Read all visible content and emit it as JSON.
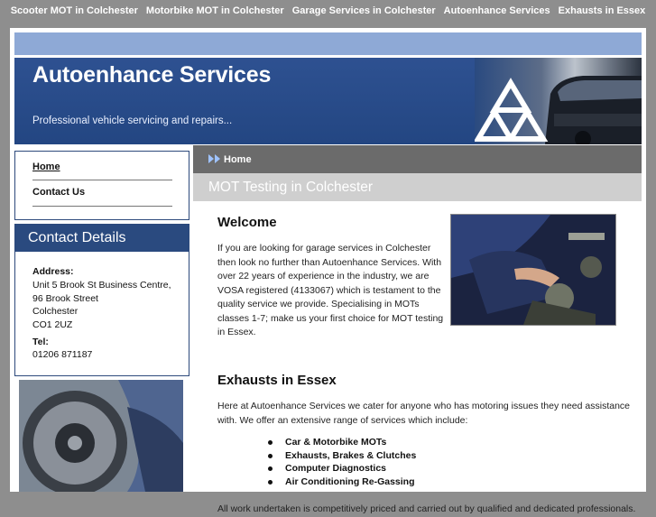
{
  "topnav": [
    "Scooter MOT in Colchester",
    "Motorbike MOT in Colchester",
    "Garage Services in Colchester",
    "Autoenhance Services",
    "Exhausts in Essex"
  ],
  "header": {
    "title": "Autoenhance Services",
    "tagline": "Professional vehicle servicing and repairs..."
  },
  "sidebar": {
    "nav": [
      "Home",
      "Contact Us"
    ],
    "contact": {
      "heading": "Contact Details",
      "address_label": "Address:",
      "address_lines": [
        "Unit 5 Brook St Business Centre,",
        "96 Brook Street",
        "Colchester",
        "CO1 2UZ"
      ],
      "tel_label": "Tel:",
      "tel": "01206 871187"
    }
  },
  "main": {
    "breadcrumb": "Home",
    "page_title": "MOT Testing in Colchester",
    "welcome_heading": "Welcome",
    "welcome_lines": [
      "If you are looking for garage services in Colchester",
      "then look no further than Autoenhance Services. With",
      "over 22 years of experience in the industry, we are",
      "VOSA registered (4133067) which is testament to the",
      "quality service we provide. Specialising in MOTs",
      "classes 1-7; make us your first choice for MOT testing",
      "in Essex."
    ],
    "exhausts_heading": "Exhausts in Essex",
    "exhausts_lines": [
      "Here at Autoenhance Services we cater for anyone who has motoring issues they need assistance",
      "with. We offer an extensive range of services which include:"
    ],
    "services": [
      "Car & Motorbike MOTs",
      "Exhausts, Brakes & Clutches",
      "Computer Diagnostics",
      "Air Conditioning Re-Gassing"
    ],
    "footer_line": "All work undertaken is competitively priced and carried out by qualified and dedicated professionals."
  },
  "colors": {
    "banner": "#2e5191",
    "stripe": "#8ea9d6",
    "page_bg": "#8e8e8e",
    "crumb_bar": "#6b6b6b"
  }
}
